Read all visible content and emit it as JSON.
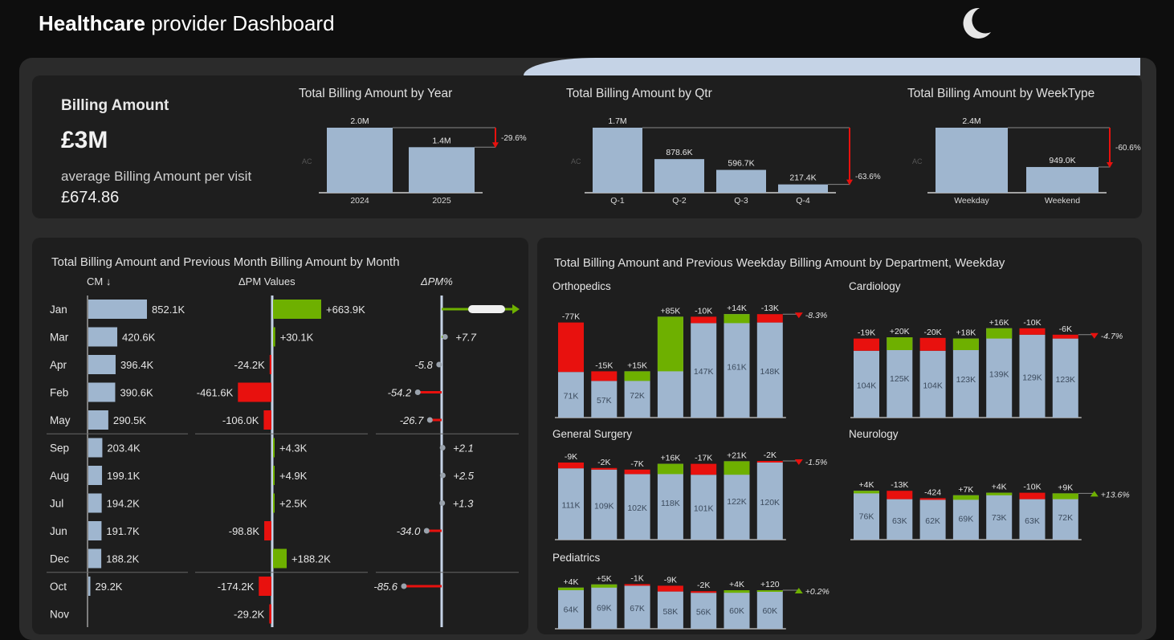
{
  "header": {
    "title_bold": "Healthcare",
    "title_rest": " provider Dashboard",
    "moon_icon": "moon-icon"
  },
  "colors": {
    "bar": "#9fb6cf",
    "pos": "#6eb000",
    "neg": "#e8110e",
    "axis": "#c5d3e6"
  },
  "kpi": {
    "label": "Billing Amount",
    "value": "£3M",
    "sub_label": "average Billing Amount per visit",
    "avg_value": "£674.86"
  },
  "chart_data": [
    {
      "id": "year",
      "type": "bar",
      "title": "Total Billing Amount by Year",
      "ylabel": "AC",
      "categories": [
        "2024",
        "2025"
      ],
      "values": [
        2.0,
        1.4
      ],
      "unit": "M",
      "value_labels": [
        "2.0M",
        "1.4M"
      ],
      "variance_label": "-29.6%"
    },
    {
      "id": "qtr",
      "type": "bar",
      "title": "Total Billing Amount by Qtr",
      "ylabel": "AC",
      "categories": [
        "Q-1",
        "Q-2",
        "Q-3",
        "Q-4"
      ],
      "values": [
        1700,
        878.6,
        596.7,
        217.4
      ],
      "unit": "K",
      "value_labels": [
        "1.7M",
        "878.6K",
        "596.7K",
        "217.4K"
      ],
      "variance_label": "-63.6%"
    },
    {
      "id": "weektype",
      "type": "bar",
      "title": "Total Billing Amount by WeekType",
      "ylabel": "AC",
      "categories": [
        "Weekday",
        "Weekend"
      ],
      "values": [
        2400,
        949.0
      ],
      "unit": "K",
      "value_labels": [
        "2.4M",
        "949.0K"
      ],
      "variance_label": "-60.6%"
    },
    {
      "id": "month",
      "type": "bar",
      "title": "Total Billing Amount and Previous Month Billing Amount by Month",
      "column_headers": [
        "CM ↓",
        "ΔPM Values",
        "ΔPM%"
      ],
      "categories": [
        "Jan",
        "Mar",
        "Apr",
        "Feb",
        "May",
        "Sep",
        "Aug",
        "Jul",
        "Jun",
        "Dec",
        "Oct",
        "Nov"
      ],
      "cm": [
        852.1,
        420.6,
        396.4,
        390.6,
        290.5,
        203.4,
        199.1,
        194.2,
        191.7,
        188.2,
        29.2,
        null
      ],
      "cm_labels": [
        "852.1K",
        "420.6K",
        "396.4K",
        "390.6K",
        "290.5K",
        "203.4K",
        "199.1K",
        "194.2K",
        "191.7K",
        "188.2K",
        "29.2K",
        ""
      ],
      "delta": [
        663.9,
        30.1,
        -24.2,
        -461.6,
        -106.0,
        4.3,
        4.9,
        2.5,
        -98.8,
        188.2,
        -174.2,
        -29.2
      ],
      "delta_labels": [
        "+663.9K",
        "+30.1K",
        "-24.2K",
        "-461.6K",
        "-106.0K",
        "+4.3K",
        "+4.9K",
        "+2.5K",
        "-98.8K",
        "+188.2K",
        "-174.2K",
        "-29.2K"
      ],
      "pct": [
        null,
        7.7,
        -5.8,
        -54.2,
        -26.7,
        2.1,
        2.5,
        1.3,
        -34.0,
        null,
        -85.6,
        null
      ],
      "pct_labels": [
        "",
        "+7.7",
        "-5.8",
        "-54.2",
        "-26.7",
        "+2.1",
        "+2.5",
        "+1.3",
        "-34.0",
        "",
        "-85.6",
        ""
      ],
      "separators_after": [
        4,
        9
      ]
    },
    {
      "id": "dept",
      "type": "bar",
      "title": "Total Billing Amount and Previous Weekday Billing Amount by Department, Weekday",
      "panels": [
        {
          "name": "Orthopedics",
          "values": [
            71,
            57,
            72,
            157,
            147,
            161,
            148
          ],
          "value_labels": [
            "71K",
            "57K",
            "72K",
            "157K",
            "147K",
            "161K",
            "148K"
          ],
          "deltas": [
            -77,
            -15,
            15,
            85,
            -10,
            14,
            -13
          ],
          "delta_labels": [
            "-77K",
            "-15K",
            "+15K",
            "+85K",
            "-10K",
            "+14K",
            "-13K"
          ],
          "total_label": "-8.3%"
        },
        {
          "name": "Cardiology",
          "values": [
            104,
            125,
            104,
            123,
            139,
            129,
            123
          ],
          "value_labels": [
            "104K",
            "125K",
            "104K",
            "123K",
            "139K",
            "129K",
            "123K"
          ],
          "deltas": [
            -19,
            20,
            -20,
            18,
            16,
            -10,
            -6
          ],
          "delta_labels": [
            "-19K",
            "+20K",
            "-20K",
            "+18K",
            "+16K",
            "-10K",
            "-6K"
          ],
          "total_label": "-4.7%"
        },
        {
          "name": "General Surgery",
          "values": [
            111,
            109,
            102,
            118,
            101,
            122,
            120
          ],
          "value_labels": [
            "111K",
            "109K",
            "102K",
            "118K",
            "101K",
            "122K",
            "120K"
          ],
          "deltas": [
            -9,
            -2,
            -7,
            16,
            -17,
            21,
            -2
          ],
          "delta_labels": [
            "-9K",
            "-2K",
            "-7K",
            "+16K",
            "-17K",
            "+21K",
            "-2K"
          ],
          "total_label": "-1.5%"
        },
        {
          "name": "Neurology",
          "values": [
            76,
            63,
            62,
            69,
            73,
            63,
            72
          ],
          "value_labels": [
            "76K",
            "63K",
            "62K",
            "69K",
            "73K",
            "63K",
            "72K"
          ],
          "deltas": [
            4,
            -13,
            -0.424,
            7,
            4,
            -10,
            9
          ],
          "delta_labels": [
            "+4K",
            "-13K",
            "-424",
            "+7K",
            "+4K",
            "-10K",
            "+9K"
          ],
          "total_label": "+13.6%"
        },
        {
          "name": "Pediatrics",
          "values": [
            64,
            69,
            67,
            58,
            56,
            60,
            60
          ],
          "value_labels": [
            "64K",
            "69K",
            "67K",
            "58K",
            "56K",
            "60K",
            "60K"
          ],
          "deltas": [
            4,
            5,
            -1,
            -9,
            -2,
            4,
            0.12
          ],
          "delta_labels": [
            "+4K",
            "+5K",
            "-1K",
            "-9K",
            "-2K",
            "+4K",
            "+120"
          ],
          "total_label": "+0.2%"
        }
      ]
    }
  ]
}
